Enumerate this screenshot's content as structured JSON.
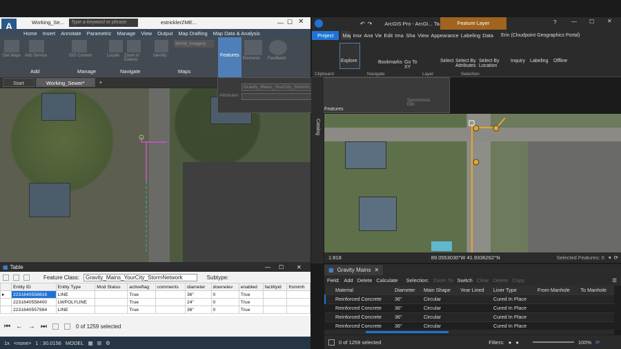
{
  "left": {
    "title_tabs": [
      "Working_Se..."
    ],
    "search_placeholder": "Type a keyword or phrase",
    "user": "estricklerZME...",
    "menu": [
      "Home",
      "Insert",
      "Annotate",
      "Parametric",
      "Manage",
      "View",
      "Output",
      "Map Drafting",
      "Map Data & Analysis"
    ],
    "ribbon_items": [
      "Get Maps",
      "Add Service",
      "GIS Content",
      "Locate",
      "Zoom to Extents",
      "Identify",
      "World_Imagery",
      "Features",
      "Elements",
      "Feedback"
    ],
    "groups": [
      "Add",
      "Manage",
      "Navigate",
      "Maps"
    ],
    "file_tabs": [
      "Start",
      "Working_Sewer*"
    ],
    "features_popup": {
      "layer": "Gravity_Mains_YourCity_StormN...",
      "label": "Features",
      "btn1": "Attributes",
      "btn2": "Synchronize Edit"
    },
    "table": {
      "title": "Table",
      "feature_class_label": "Feature Class:",
      "feature_class_value": "Gravity_Mains_YourCity_StormNetwork",
      "subtype_label": "Subtype:",
      "columns": [
        "Entity ID",
        "Entity Type",
        "Mod Status",
        "activeflag",
        "comments",
        "diameter",
        "downelev",
        "enabled",
        "facilityid",
        "frommh"
      ],
      "rows": [
        [
          "2231640558816",
          "LINE",
          "",
          "True",
          "",
          "36\"",
          "0",
          "True",
          "",
          ""
        ],
        [
          "2231640558400",
          "LWPOLYLINE",
          "",
          "True",
          "",
          "24\"",
          "0",
          "True",
          "",
          ""
        ],
        [
          "2231640557984",
          "LINE",
          "",
          "True",
          "",
          "36\"",
          "0",
          "True",
          "",
          ""
        ]
      ],
      "selected_text": "0 of 1259 selected"
    },
    "status": {
      "scale": "1 : 30.0156",
      "model": "MODEL",
      "none": "<none>",
      "zoom": "1x"
    }
  },
  "right": {
    "title": "ArcGIS Pro - ArcGI... Ta...",
    "contextual": "Feature Layer",
    "tabs": [
      "Project",
      "Map",
      "Insert",
      "Analysis",
      "View",
      "Edit",
      "Imagery",
      "Share",
      "View",
      "Appearance",
      "Labeling",
      "Data"
    ],
    "user": "Erin (Cloudpoint Geographics Portal)",
    "ribbon": [
      "Explore",
      "Bookmarks",
      "Go To XY",
      "Select",
      "Select By Attributes",
      "Select By Location",
      "Inquiry",
      "Labeling",
      "Offline"
    ],
    "groups": [
      "Clipboard",
      "Navigate",
      "Layer",
      "Selection"
    ],
    "catalog": "Catalog",
    "map_scale": "1:818",
    "coords": "89.0553030°W 41.9336262°N",
    "selected_features": "Selected Features: 0",
    "attr_tab": "Gravity Mains",
    "field_toolbar": [
      "Field:",
      "Add",
      "Delete",
      "Calculate",
      "Selection:",
      "Zoom To",
      "Switch",
      "Clear",
      "Delete",
      "Copy"
    ],
    "columns": [
      "Material",
      "Diameter",
      "Main Shape",
      "Year Lined",
      "Liner Type",
      "From Manhole",
      "To Manhole"
    ],
    "rows": [
      [
        "Reinforced Concrete",
        "36\"",
        "Circular",
        "",
        "Cured In Place",
        "",
        ""
      ],
      [
        "Reinforced Concrete",
        "36\"",
        "Circular",
        "",
        "Cured In Place",
        "",
        ""
      ],
      [
        "Reinforced Concrete",
        "36\"",
        "Circular",
        "",
        "Cured In Place",
        "",
        ""
      ],
      [
        "Reinforced Concrete",
        "36\"",
        "Circular",
        "",
        "Cured In Place",
        "",
        ""
      ]
    ],
    "selected_text": "0 of 1259 selected",
    "filters": "Filters:",
    "zoom": "100%"
  },
  "colors": {
    "accent_blue": "#1e74d6",
    "sewer_orange": "#e8a52b",
    "ribbon_blue_sel": "#4f7fb8"
  }
}
